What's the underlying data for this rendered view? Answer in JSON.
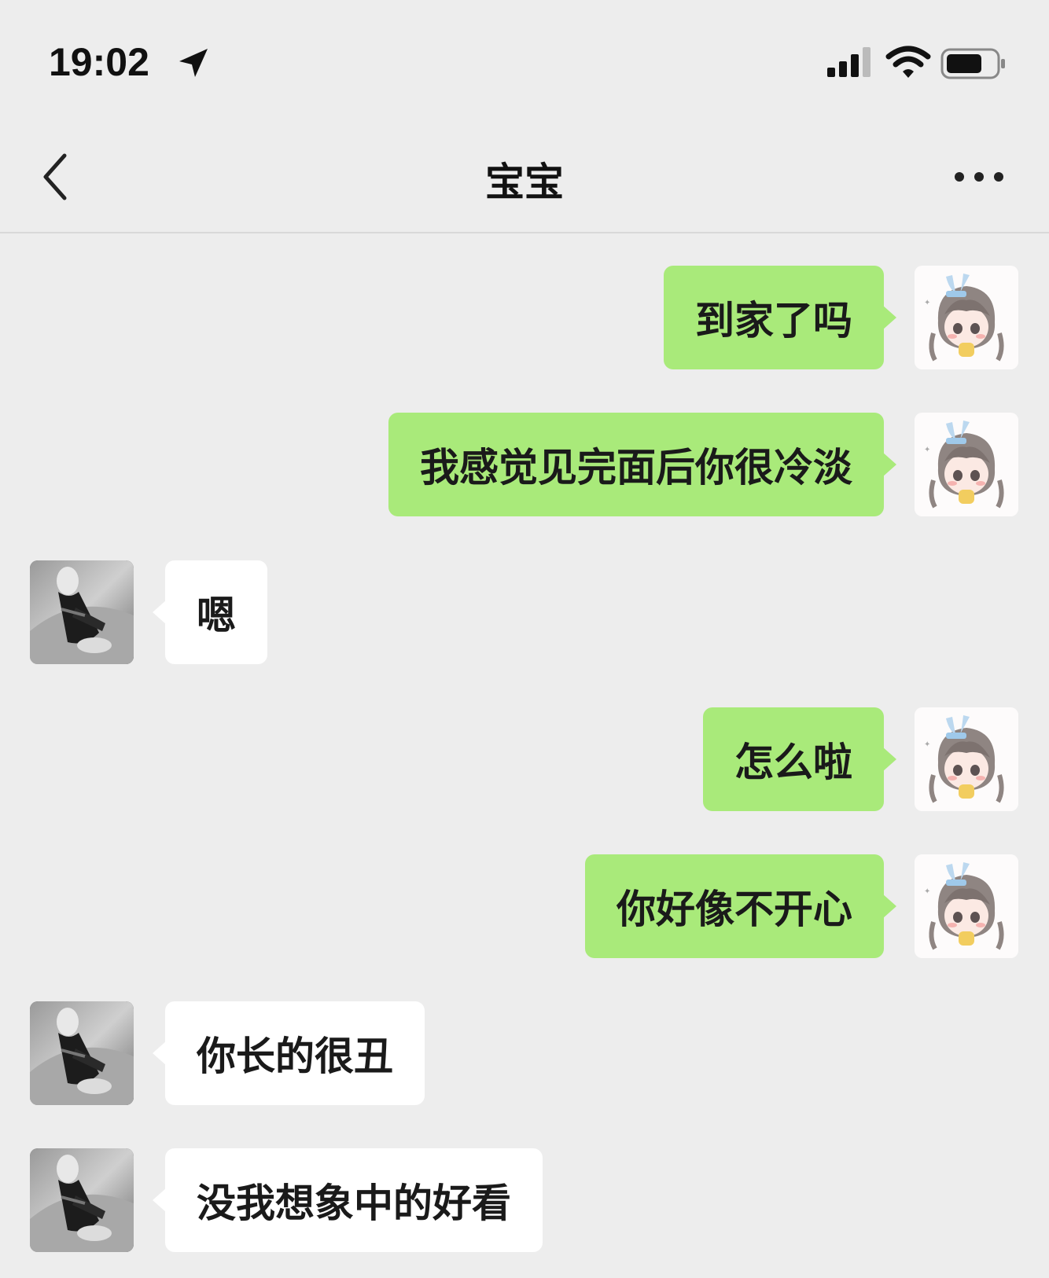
{
  "status_bar": {
    "time": "19:02",
    "icons": [
      "location-arrow-icon",
      "cellular-signal-icon",
      "wifi-icon",
      "battery-icon"
    ]
  },
  "nav": {
    "title": "宝宝",
    "back_icon": "chevron-left-icon",
    "more_icon": "more-dots-icon"
  },
  "colors": {
    "background": "#ededed",
    "sent_bubble": "#a9ea7a",
    "received_bubble": "#ffffff"
  },
  "messages": [
    {
      "sender": "me",
      "text": "到家了吗"
    },
    {
      "sender": "me",
      "text": "我感觉见完面后你很冷淡"
    },
    {
      "sender": "them",
      "text": "嗯"
    },
    {
      "sender": "me",
      "text": "怎么啦"
    },
    {
      "sender": "me",
      "text": "你好像不开心"
    },
    {
      "sender": "them",
      "text": "你长的很丑"
    },
    {
      "sender": "them",
      "text": "没我想象中的好看"
    }
  ]
}
